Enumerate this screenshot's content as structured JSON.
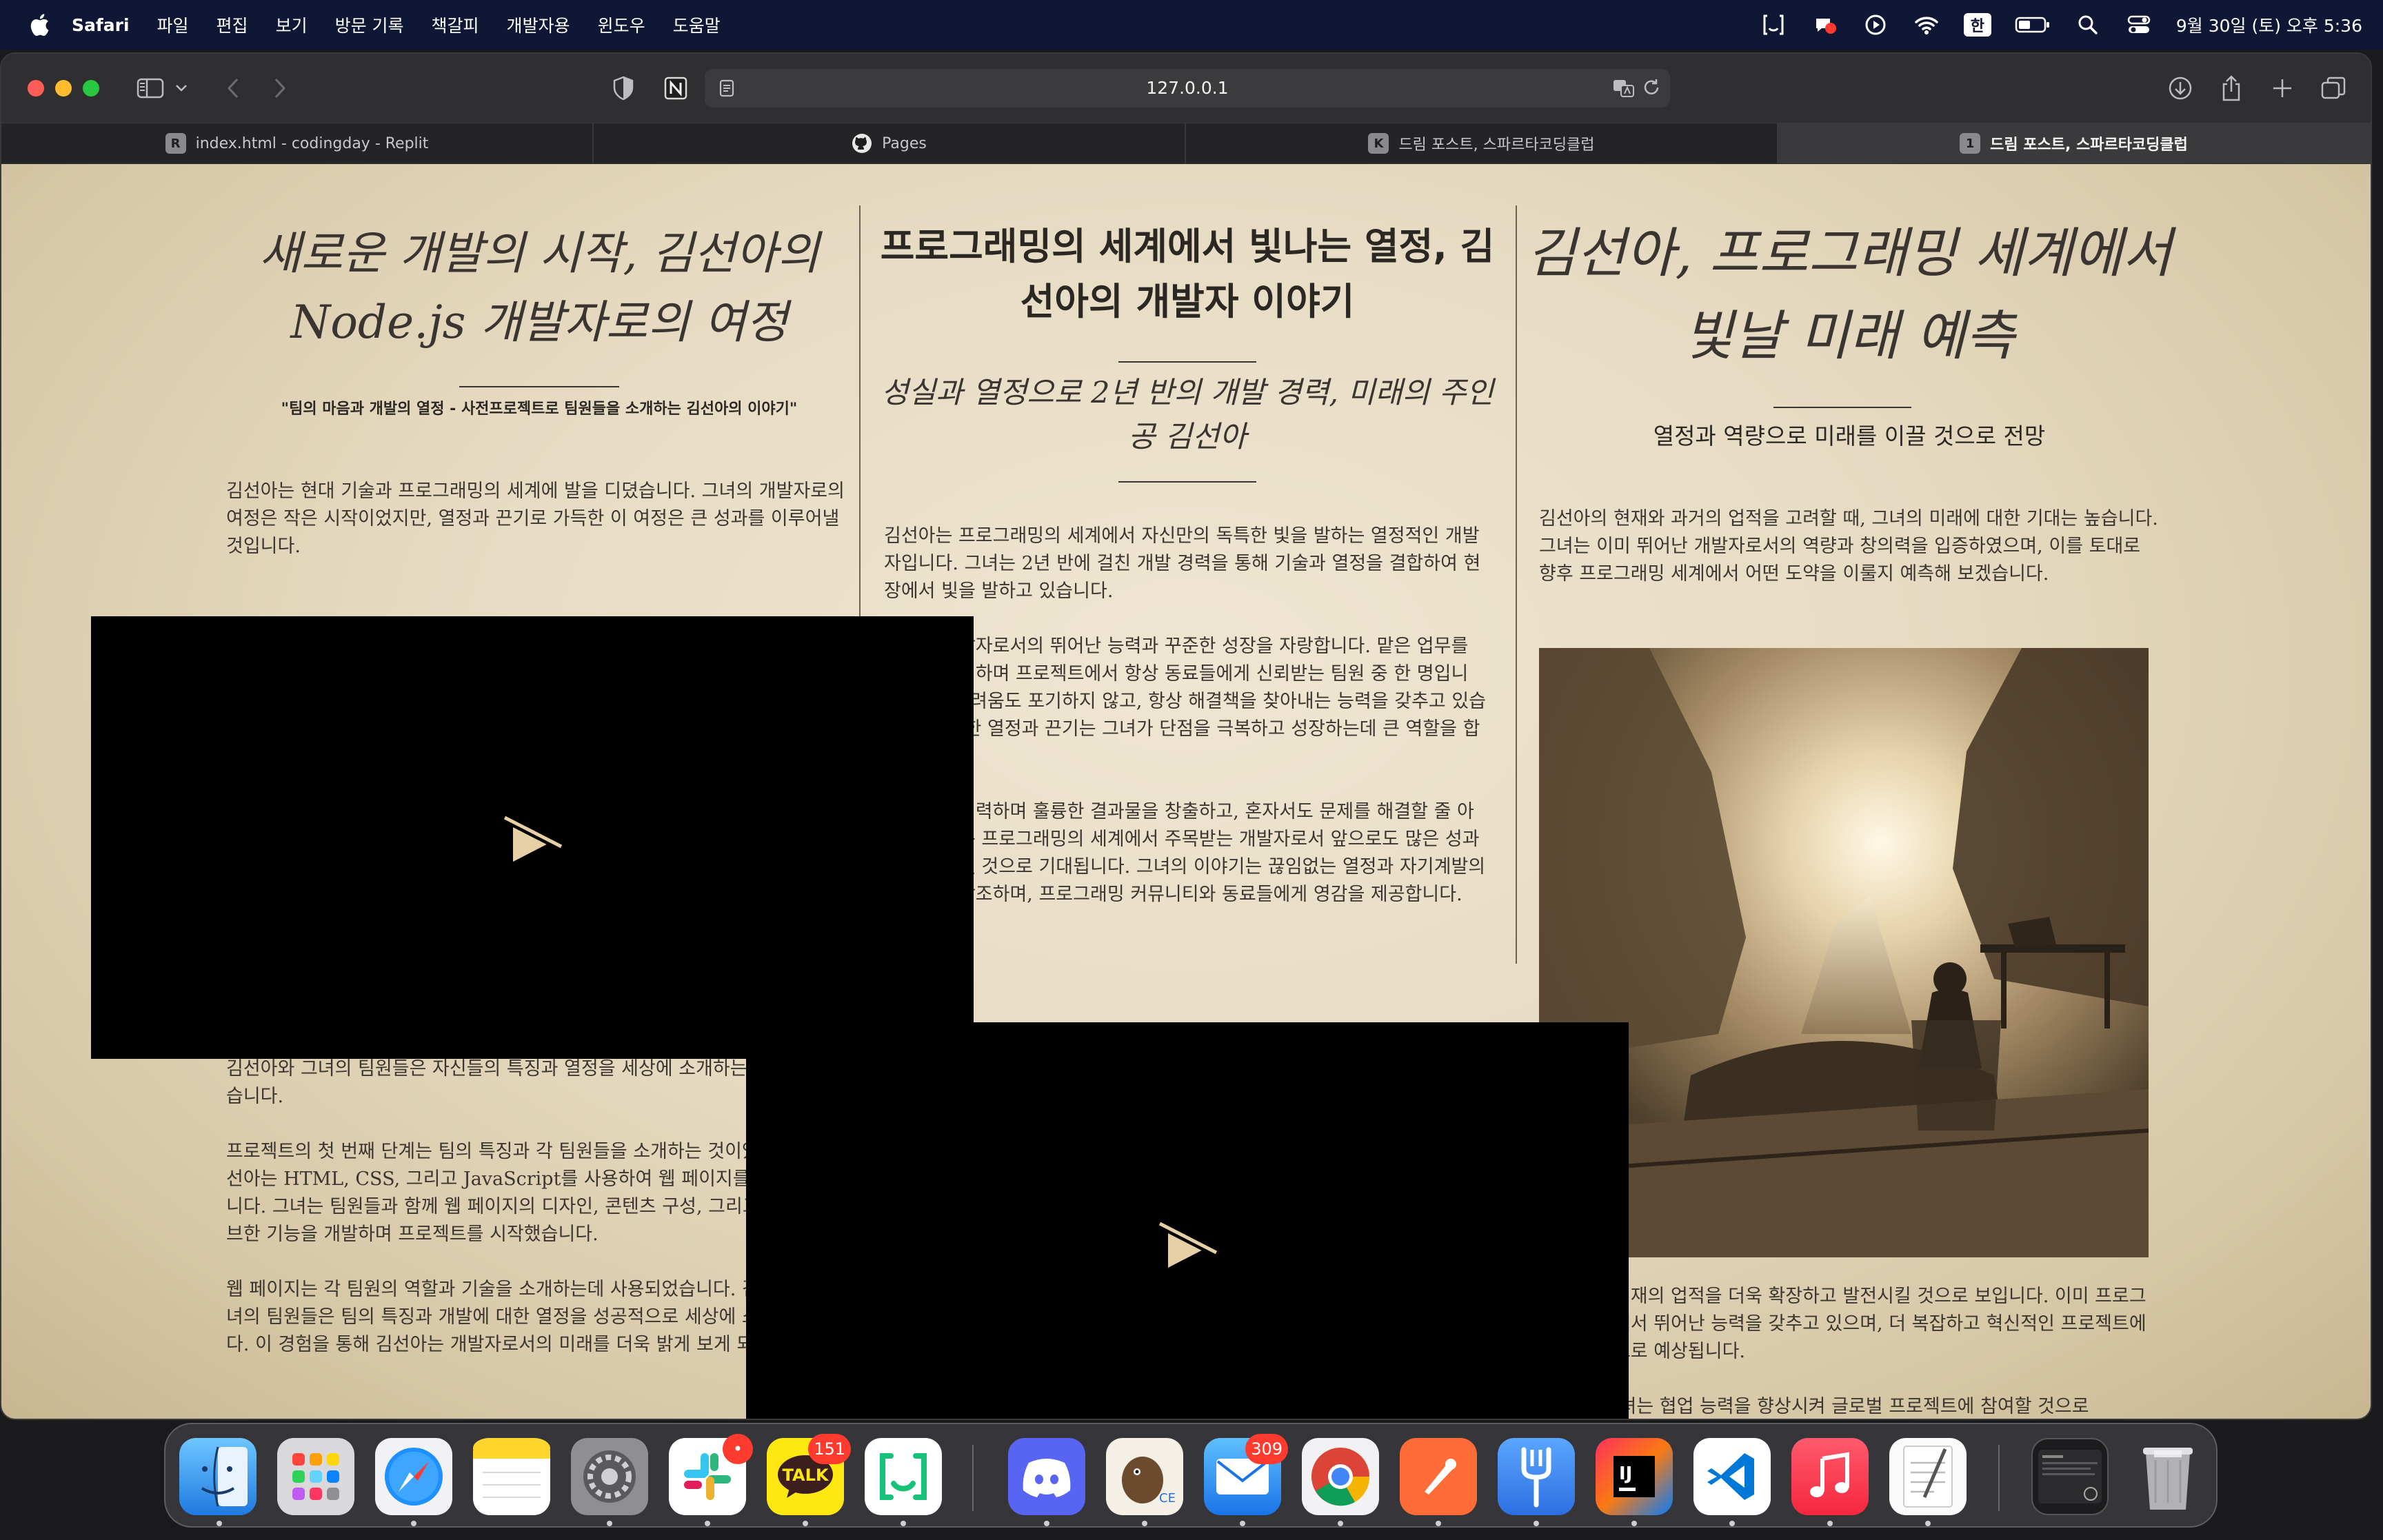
{
  "menubar": {
    "app": "Safari",
    "items": [
      "파일",
      "편집",
      "보기",
      "방문 기록",
      "책갈피",
      "개발자용",
      "윈도우",
      "도움말"
    ],
    "input_source": "한",
    "clock": "9월 30일 (토) 오후 5:36"
  },
  "browser": {
    "url": "127.0.0.1",
    "tabs": [
      {
        "favicon": "R",
        "label": "index.html - codingday - Replit"
      },
      {
        "favicon": "github",
        "label": "Pages"
      },
      {
        "favicon": "K",
        "label": "드림 포스트, 스파르타코딩클럽"
      },
      {
        "favicon": "1",
        "label": "드림 포스트, 스파르타코딩클럽"
      }
    ]
  },
  "article": {
    "col1": {
      "title": "새로운 개발의 시작, 김선아의 Node.js 개발자로의 여정",
      "subtitle": "\"팀의 마음과 개발의 열정 - 사전프로젝트로 팀원들을 소개하는 김선아의 이야기\"",
      "p1": "김선아는 현대 기술과 프로그래밍의 세계에 발을 디뎠습니다. 그녀의 개발자로의 여정은 작은 시작이었지만, 열정과 끈기로 가득한 이 여정은 큰 성과를 이루어낼 것입니다.",
      "p2": "사전캠프 프로젝트는 그녀의 개발자로의 첫 걸음이었습니다. 이 프로젝트를 통해 김선아와 그녀의 팀원들은 자신들의 특징과 열정을 세상에 소개하는 기회를 얻었습니다.",
      "p3": "프로젝트의 첫 번째 단계는 팀의 특징과 각 팀원들을 소개하는 것이었습니다. 김선아는 HTML, CSS, 그리고 JavaScript를 사용하여 웹 페이지를 구현하였습니다. 그녀는 팀원들과 함께 웹 페이지의 디자인, 콘텐츠 구성, 그리고 인터랙티브한 기능을 개발하며 프로젝트를 시작했습니다.",
      "p4": "웹 페이지는 각 팀원의 역할과 기술을 소개하는데 사용되었습니다. 김선아와 그녀의 팀원들은 팀의 특징과 개발에 대한 열정을 성공적으로 세상에 소개하였습니다. 이 경험을 통해 김선아는 개발자로서의 미래를 더욱 밝게 보게 되었습니다."
    },
    "col2": {
      "title": "프로그래밍의 세계에서 빛나는 열정, 김선아의 개발자 이야기",
      "subtitle": "성실과 열정으로 2년 반의 개발 경력, 미래의 주인공 김선아",
      "p1": "김선아는 프로그래밍의 세계에서 자신만의 독특한 빛을 발하는 열정적인 개발자입니다. 그녀는 2년 반에 걸친 개발 경력을 통해 기술과 열정을 결합하여 현장에서 빛을 발하고 있습니다.",
      "p2": "그녀는 개발자로서의 뛰어난 능력과 꾸준한 성장을 자랑합니다. 맡은 업무를 성실히 처리하며 프로젝트에서 항상 동료들에게 신뢰받는 팀원 중 한 명입니다. 어떤 어려움도 포기하지 않고, 항상 해결책을 찾아내는 능력을 갖추고 있습니다. 이러한 열정과 끈기는 그녀가 단점을 극복하고 성장하는데 큰 역할을 합니다.",
      "p3": "동료들과 협력하며 훌륭한 결과물을 창출하고, 혼자서도 문제를 해결할 줄 아는 김선아는 프로그래밍의 세계에서 주목받는 개발자로서 앞으로도 많은 성과를 이루어낼 것으로 기대됩니다. 그녀의 이야기는 끊임없는 열정과 자기계발의 중요성을 강조하며, 프로그래밍 커뮤니티와 동료들에게 영감을 제공합니다."
    },
    "col3": {
      "title": "김선아, 프로그래밍 세계에서 빛날 미래 예측",
      "subtitle": "열정과 역량으로 미래를 이끌 것으로 전망",
      "p1": "김선아의 현재와 과거의 업적을 고려할 때, 그녀의 미래에 대한 기대는 높습니다. 그녀는 이미 뛰어난 개발자로서의 역량과 창의력을 입증하였으며, 이를 토대로 향후 프로그래밍 세계에서 어떤 도약을 이룰지 예측해 보겠습니다.",
      "p2": "김선아는 현재의 업적을 더욱 확장하고 발전시킬 것으로 보입니다. 이미 프로그래밍 분야에서 뛰어난 능력을 갖추고 있으며, 더 복잡하고 혁신적인 프로젝트에 참여할 것으로 예상됩니다.",
      "p3": "둘째로, 그녀는 협업 능력을 향상시켜 글로벌 프로젝트에 참여할 것으로"
    }
  },
  "dock": {
    "apps": [
      {
        "name": "Finder",
        "icon": "finder-icon",
        "badge": ""
      },
      {
        "name": "Launchpad",
        "icon": "launchpad-icon",
        "badge": ""
      },
      {
        "name": "Safari",
        "icon": "safari-icon",
        "badge": ""
      },
      {
        "name": "Notes",
        "icon": "notes-icon",
        "badge": ""
      },
      {
        "name": "System Settings",
        "icon": "settings-icon",
        "badge": ""
      },
      {
        "name": "Slack",
        "icon": "slack-icon",
        "badge": "•"
      },
      {
        "name": "KakaoTalk",
        "icon": "kakaotalk-icon",
        "badge": "151"
      },
      {
        "name": "Line Works",
        "icon": "bracket-icon",
        "badge": ""
      },
      {
        "name": "Discord",
        "icon": "discord-icon",
        "badge": ""
      },
      {
        "name": "DBeaver",
        "icon": "dbeaver-icon",
        "badge": ""
      },
      {
        "name": "Mail",
        "icon": "mail-icon",
        "badge": "309"
      },
      {
        "name": "Chrome",
        "icon": "chrome-icon",
        "badge": ""
      },
      {
        "name": "Postman",
        "icon": "postman-icon",
        "badge": ""
      },
      {
        "name": "Fork",
        "icon": "fork-icon",
        "badge": ""
      },
      {
        "name": "IntelliJ IDEA",
        "icon": "intellij-icon",
        "badge": ""
      },
      {
        "name": "VS Code",
        "icon": "vscode-icon",
        "badge": ""
      },
      {
        "name": "Music",
        "icon": "music-icon",
        "badge": ""
      },
      {
        "name": "TextEdit",
        "icon": "textedit-icon",
        "badge": ""
      },
      {
        "name": "Screenshot",
        "icon": "window-thumbnail-icon",
        "badge": ""
      },
      {
        "name": "Trash",
        "icon": "trash-icon",
        "badge": ""
      }
    ]
  }
}
